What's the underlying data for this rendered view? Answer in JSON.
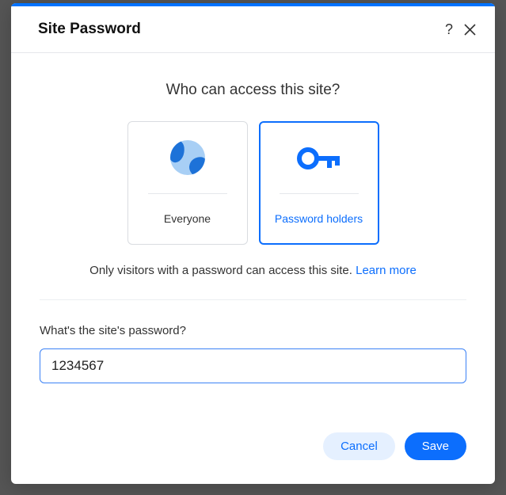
{
  "header": {
    "title": "Site Password"
  },
  "access": {
    "question": "Who can access this site?",
    "options": {
      "everyone": {
        "label": "Everyone"
      },
      "password_holders": {
        "label": "Password holders"
      }
    },
    "helper_text": "Only visitors with a password can access this site. ",
    "learn_more": "Learn more"
  },
  "password": {
    "label": "What's the site's password?",
    "value": "1234567"
  },
  "footer": {
    "cancel": "Cancel",
    "save": "Save"
  }
}
